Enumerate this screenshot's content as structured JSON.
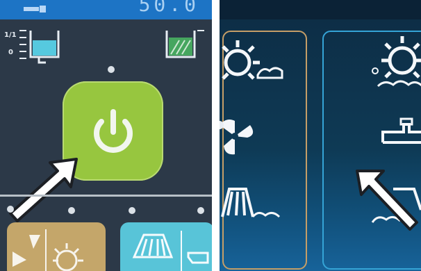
{
  "left_panel": {
    "display_value": "50.0",
    "tank_labels": [
      "1/1",
      "0"
    ]
  }
}
